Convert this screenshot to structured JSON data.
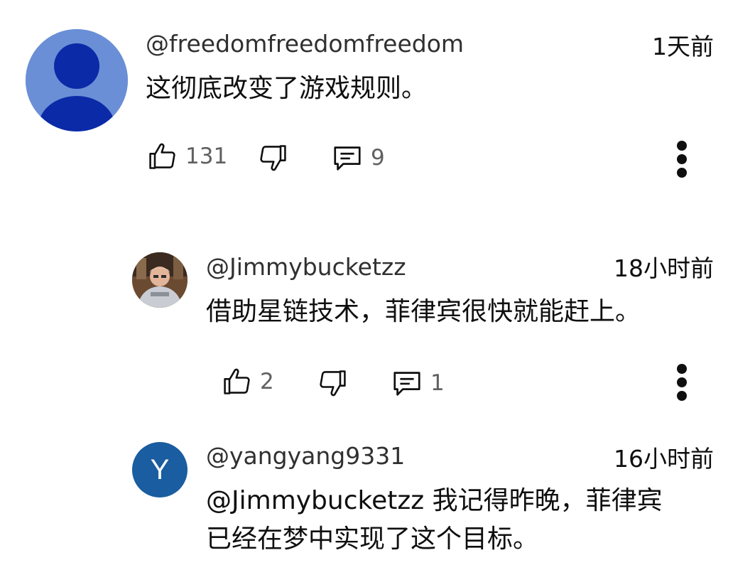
{
  "comments": [
    {
      "handle": "@freedomfreedomfreedom",
      "time": "1天前",
      "text": "这彻底改变了游戏规则。",
      "likes": "131",
      "replies": "9"
    },
    {
      "handle": "@Jimmybucketzz",
      "time": "18小时前",
      "text": "借助星链技术，菲律宾很快就能赶上。",
      "likes": "2",
      "replies": "1"
    },
    {
      "handle": "@yangyang9331",
      "time": "16小时前",
      "avatar_letter": "Y",
      "text_line1": "@Jimmybucketzz 我记得昨晚，菲律宾",
      "text_line2": "已经在梦中实现了这个目标。"
    }
  ],
  "colors": {
    "avatar_default_bg": "#6b8fd6",
    "avatar_default_fg": "#0a2aa8",
    "avatar_letter_bg": "#1a5da0"
  },
  "icons": [
    "like-icon",
    "dislike-icon",
    "reply-icon",
    "more-vert-icon"
  ]
}
